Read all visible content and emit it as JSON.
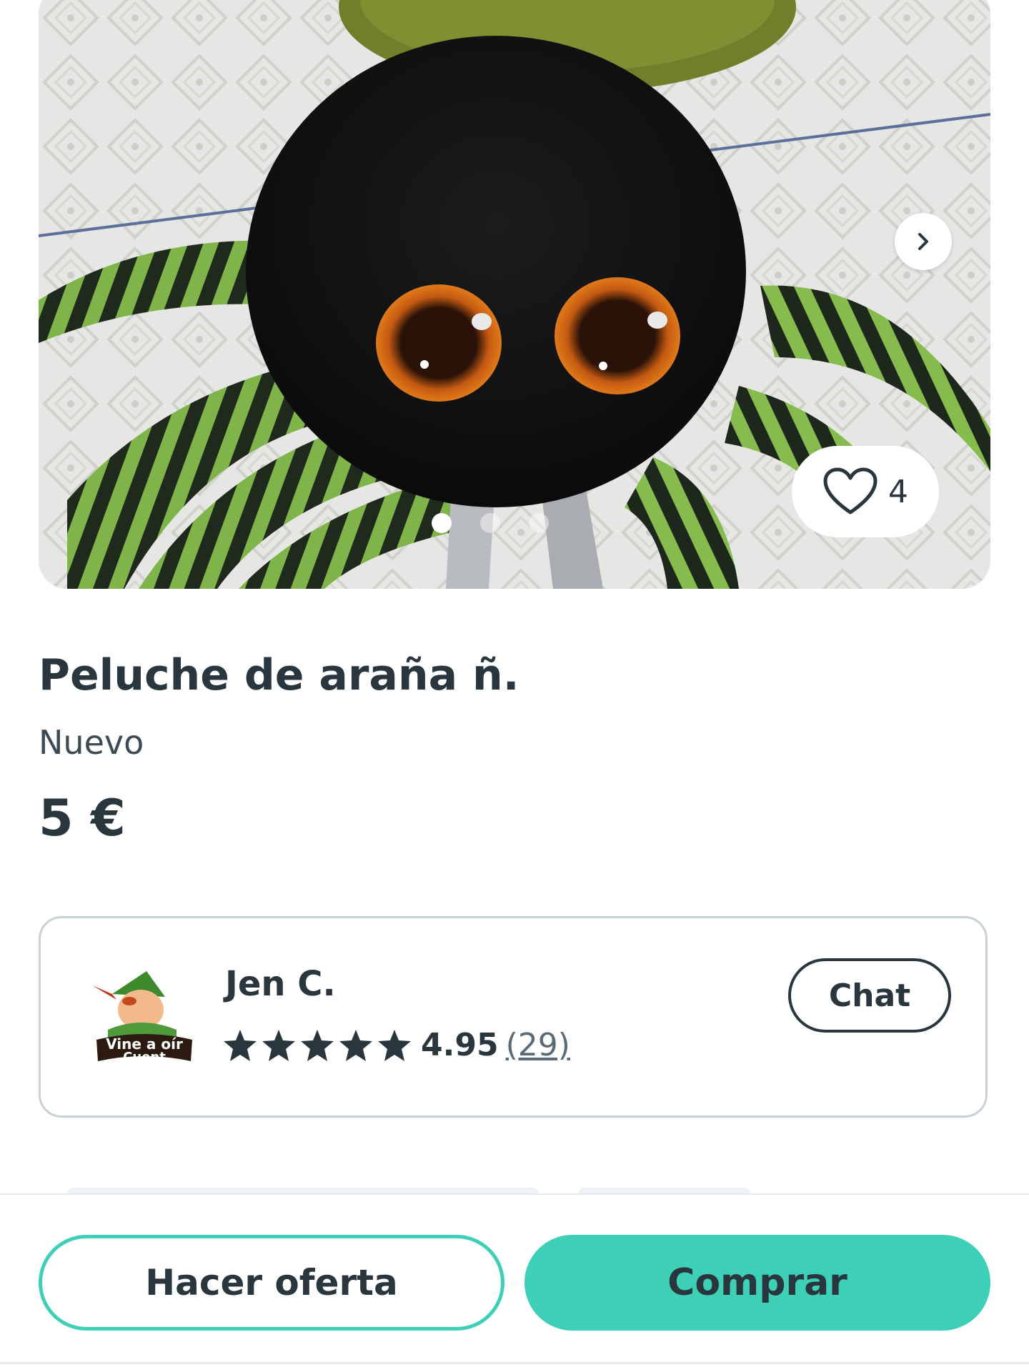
{
  "gallery": {
    "favorites_count": "4",
    "dots_total": 3,
    "dots_active_index": 0,
    "next_icon": "chevron-right-icon",
    "favorite_icon": "heart-outline-icon"
  },
  "product": {
    "title": "Peluche de araña ñ.",
    "condition": "Nuevo",
    "price": "5 €"
  },
  "seller": {
    "name": "Jen C.",
    "avatar_caption_line1": "Vine a oír",
    "avatar_caption_line2": "Cuent",
    "stars": 5,
    "rating": "4.95",
    "reviews": "(29)",
    "chat_label": "Chat"
  },
  "actions": {
    "offer_label": "Hacer oferta",
    "buy_label": "Comprar"
  },
  "colors": {
    "accent": "#3ecfb7",
    "text": "#29363d",
    "border": "#c8d1d6"
  }
}
